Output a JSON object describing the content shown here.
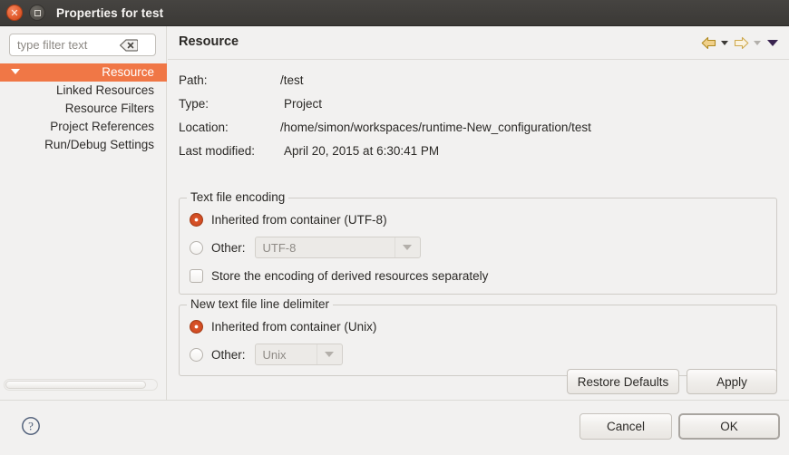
{
  "window": {
    "title": "Properties for test",
    "buttons": {
      "close": "close-window",
      "maximize": "maximize-window"
    },
    "titlebar_color": "#3b3936"
  },
  "sidebar": {
    "filter": {
      "value": "",
      "placeholder": "type filter text",
      "clear_icon": "clear-backspace-icon"
    },
    "items": [
      {
        "label": "Resource",
        "selected": true,
        "expanded": true
      },
      {
        "label": "Linked Resources",
        "selected": false
      },
      {
        "label": "Resource Filters",
        "selected": false
      },
      {
        "label": "Project References",
        "selected": false
      },
      {
        "label": "Run/Debug Settings",
        "selected": false
      }
    ],
    "selection_color": "#f07746"
  },
  "main": {
    "title": "Resource",
    "nav": {
      "back_icon": "arrow-left-icon",
      "back_menu_icon": "chevron-down-icon",
      "forward_icon": "arrow-right-icon",
      "forward_menu_icon": "chevron-down-icon",
      "view_menu_icon": "chevron-down-icon"
    },
    "properties": [
      {
        "label": "Path:",
        "value": "/test"
      },
      {
        "label": "Type:",
        "value": "Project"
      },
      {
        "label": "Location:",
        "value": "/home/simon/workspaces/runtime-New_configuration/test"
      },
      {
        "label": "Last modified:",
        "value": "April 20, 2015 at 6:30:41 PM"
      }
    ],
    "encoding_group": {
      "legend": "Text file encoding",
      "inherited_label": "Inherited from container (UTF-8)",
      "inherited_selected": true,
      "other_label": "Other:",
      "other_selected": false,
      "other_value": "UTF-8",
      "store_label": "Store the encoding of derived resources separately",
      "store_checked": false
    },
    "delimiter_group": {
      "legend": "New text file line delimiter",
      "inherited_label": "Inherited from container (Unix)",
      "inherited_selected": true,
      "other_label": "Other:",
      "other_selected": false,
      "other_value": "Unix"
    },
    "restore_defaults_label": "Restore Defaults",
    "apply_label": "Apply"
  },
  "footer": {
    "help_icon": "help-question-icon",
    "cancel_label": "Cancel",
    "ok_label": "OK"
  }
}
